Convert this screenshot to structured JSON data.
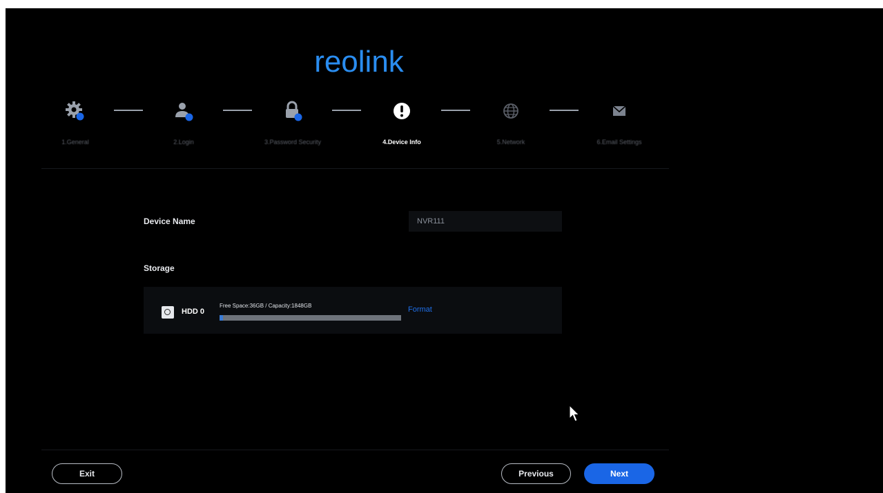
{
  "app": {
    "logo_text": "reolink",
    "brand_color": "#2a8df0"
  },
  "stepper": {
    "steps": [
      {
        "number": "1",
        "label": "1.General",
        "icon": "gear-icon",
        "status": "done"
      },
      {
        "number": "2",
        "label": "2.Login",
        "icon": "user-icon",
        "status": "done"
      },
      {
        "number": "3",
        "label": "3.Password Security",
        "icon": "lock-icon",
        "status": "done"
      },
      {
        "number": "4",
        "label": "4.Device Info",
        "icon": "info-icon",
        "status": "active"
      },
      {
        "number": "5",
        "label": "5.Network",
        "icon": "globe-icon",
        "status": "pending"
      },
      {
        "number": "6",
        "label": "6.Email Settings",
        "icon": "mail-icon",
        "status": "pending"
      }
    ],
    "check_badge_color": "#1a66e6"
  },
  "form": {
    "device_name_label": "Device Name",
    "device_name_value": "NVR111",
    "storage_label": "Storage",
    "hdd": {
      "name": "HDD 0",
      "info": "Free Space:36GB / Capacity:1848GB",
      "used_fraction": 0.02,
      "format_label": "Format"
    }
  },
  "footer": {
    "exit_label": "Exit",
    "previous_label": "Previous",
    "next_label": "Next",
    "accent": "#1a66e6"
  }
}
